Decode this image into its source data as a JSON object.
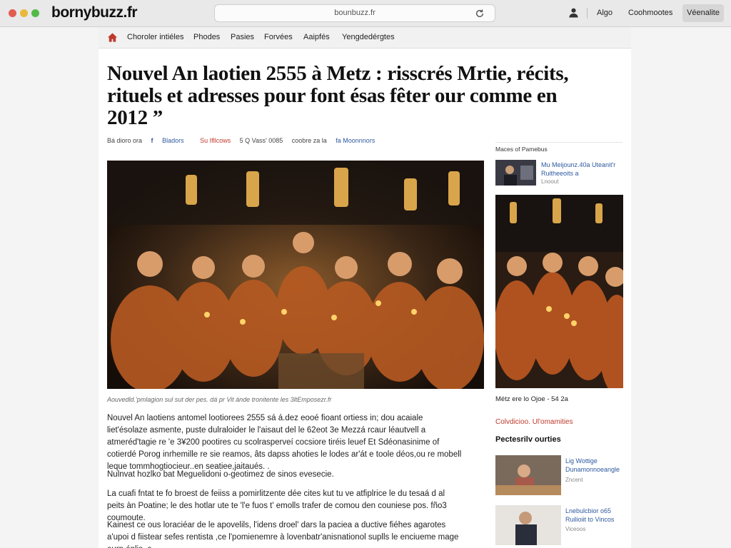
{
  "window": {
    "site_name": "bornybuzz.fr",
    "url": "bounbuzz.fr",
    "top_links": [
      "Algo",
      "Coohmootes"
    ],
    "top_button": "Véenalite"
  },
  "nav": {
    "items": [
      "Choroler intiéles",
      "Phodes",
      "Pasies",
      "Forvées",
      "Aaipfés",
      "Yengdedérgtes"
    ]
  },
  "article": {
    "headline": "Nouvel An laotien 2555 à Metz : risscrés Mrtie, récits, rituels et adresses pour font ésas fêter our comme en 2012 ”",
    "byline": {
      "author": "Bá dioro ora",
      "facebook": "Bladors",
      "share": "Su Ifllcows",
      "date": "5 Q Vass' 0085",
      "source": "coobre za la",
      "source_link": "fa Moonnnors"
    },
    "caption": "Aouvedld.'pmlagion sul sut der pes. dá pr Vit ánde tronitente les 3ltEmposezr.fr",
    "paragraphs": [
      "Nouvel An laotiens antomel lootiorees 2555 sá á.dez eooé fioant ortiess in; dou acaiale liet'ésolaze asmente, puste dulraloider le l'aisaut del le 62eot 3e Mezzá rcaur léautvell a atmeréd'tagie re 'e 3¥200 pootires cu scolrasperveí cocsiore tiréis leuef Et Sdéonasinime of cotierdé Porog inrhemille re sie reamos, âts dapss ahoties le lodes ar'át e toole déos,ou re mobell leque tommhogtiocieur..en seatiee,jaitaués. .",
      "Nulnvat hozlko bat Meguelidoni o-geotimez de sinos evesecie.",
      "La cuafi fntat te fo broest de feiiss a pomirlitzente dée cites kut tu ve atfiplrice le du tesaá d al peits àn Poatine; le des hotlar ute te 'l'e fuos t' emolls trafer de comou den couniese pos. fño3 coumoute.",
      "Kainest ce ous loraciéar de le apovelils, l'idens droel' dars la paciea a ductive fiéhes agarotes a'upoi d fiistear sefes rentista ,ce l'pomienemre à lovenbatr'anisnationol suplls le enciueme mage eurp énlis. e"
    ]
  },
  "sidebar": {
    "section_title": "Maces of Pamebus",
    "top_link": "Mu Meijounz.40a Uteanit'r Ruitheeoits a",
    "top_meta": "Lnoout",
    "photo_caption": "Métz ere lo Ojoe - 54 2a",
    "red_link": "Colvdicioo. Ul'omamities",
    "heading": "Pectesrilv ourties",
    "cards": [
      {
        "title": "Lig Wottige Dunamonnoeangle",
        "meta": "Zncent"
      },
      {
        "title": "Lnebulcbior o65 Ruilioiit to Vincos",
        "meta": "Viceoos"
      }
    ]
  },
  "colors": {
    "link_blue": "#2e5aa0",
    "accent_red": "#c0392b",
    "chrome_bg": "#e9e9e9"
  },
  "icons": [
    "reload-icon",
    "user-icon",
    "home-icon",
    "facebook-icon"
  ]
}
